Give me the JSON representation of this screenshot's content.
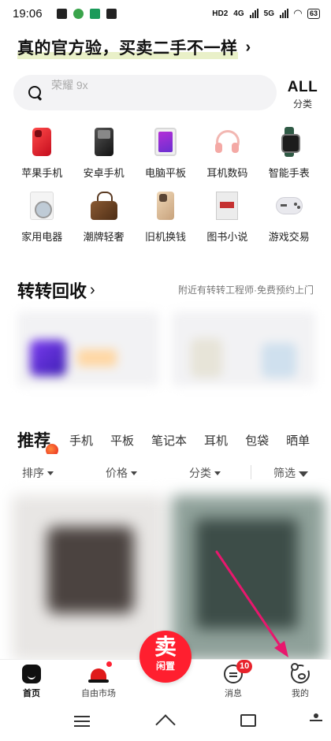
{
  "status_bar": {
    "time": "19:06",
    "hd": "HD2",
    "net1": "4G",
    "net2": "5G",
    "battery": "63"
  },
  "headline": {
    "text": "真的官方验，买卖二手不一样",
    "chevron": "›"
  },
  "search": {
    "placeholder": "荣耀 9x",
    "icon": "search-icon"
  },
  "all_category": {
    "title": "ALL",
    "subtitle": "分类"
  },
  "categories": [
    {
      "label": "苹果手机",
      "icon": "iphone-icon"
    },
    {
      "label": "安卓手机",
      "icon": "android-phone-icon"
    },
    {
      "label": "电脑平板",
      "icon": "tablet-icon"
    },
    {
      "label": "耳机数码",
      "icon": "headphone-icon"
    },
    {
      "label": "智能手表",
      "icon": "watch-icon"
    },
    {
      "label": "家用电器",
      "icon": "washer-icon"
    },
    {
      "label": "潮牌轻奢",
      "icon": "handbag-icon"
    },
    {
      "label": "旧机换钱",
      "icon": "old-phone-icon"
    },
    {
      "label": "图书小说",
      "icon": "book-icon"
    },
    {
      "label": "游戏交易",
      "icon": "gamepad-icon"
    }
  ],
  "recycle": {
    "title": "转转回收",
    "chevron": "›",
    "note": "附近有转转工程师·免费预约上门"
  },
  "recommend": {
    "active_tab": "推荐",
    "tabs": [
      "手机",
      "平板",
      "笔记本",
      "耳机",
      "包袋",
      "晒单"
    ]
  },
  "filters": {
    "sort": "排序",
    "price": "价格",
    "category": "分类",
    "screen": "筛选"
  },
  "bottom_nav": {
    "home": "首页",
    "market": "自由市场",
    "sell_big": "卖",
    "sell_small": "闲置",
    "messages": "消息",
    "messages_badge": "10",
    "me": "我的"
  },
  "colors": {
    "accent_red": "#ff1f2f",
    "annotation_arrow": "#e8176d"
  }
}
